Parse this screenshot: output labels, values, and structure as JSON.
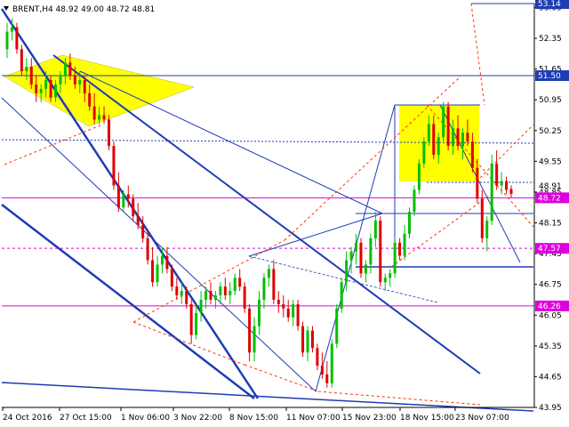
{
  "chart_data": {
    "type": "candlestick",
    "title": "BRENT,H4 48.92 49.00 48.72 48.81",
    "symbol": "BRENT",
    "timeframe": "H4",
    "ohlc": {
      "open": 48.92,
      "high": 49.0,
      "low": 48.72,
      "close": 48.81
    },
    "ylim": [
      43.95,
      53.14
    ],
    "y_ticks": [
      "53.05",
      "52.35",
      "51.65",
      "50.95",
      "50.25",
      "49.55",
      "48.85",
      "48.15",
      "47.45",
      "46.75",
      "46.05",
      "45.35",
      "44.65",
      "43.95"
    ],
    "x_tick_labels": [
      "24 Oct 2016",
      "27 Oct 15:00",
      "1 Nov 06:00",
      "3 Nov 22:00",
      "8 Nov 15:00",
      "11 Nov 07:00",
      "15 Nov 23:00",
      "18 Nov 15:00",
      "23 Nov 07:00"
    ],
    "price_levels": [
      {
        "label": "53.14",
        "value": 53.14,
        "color": "#1e3cb4"
      },
      {
        "label": "51.50",
        "value": 51.5,
        "color": "#1e3cb4"
      },
      {
        "label": "48.72",
        "value": 48.72,
        "color": "#dd00dd"
      },
      {
        "label": "47.57",
        "value": 47.57,
        "color": "#dd00dd"
      },
      {
        "label": "46.26",
        "value": 46.26,
        "color": "#dd00dd"
      }
    ],
    "hidden_tick": "48.91",
    "colors": {
      "bull": "#00c000",
      "bear": "#e00000",
      "trendline": "#1e3cb4",
      "level": "#dd00dd",
      "projection": "#ff3300",
      "highlight": "#ffff00"
    },
    "candles": [
      [
        52.1,
        52.7,
        51.9,
        52.5
      ],
      [
        52.5,
        52.8,
        52.3,
        52.6
      ],
      [
        52.6,
        52.7,
        52.0,
        52.1
      ],
      [
        52.1,
        52.2,
        51.5,
        51.6
      ],
      [
        51.6,
        51.9,
        51.4,
        51.7
      ],
      [
        51.7,
        51.9,
        51.2,
        51.3
      ],
      [
        51.3,
        51.5,
        50.9,
        51.1
      ],
      [
        51.1,
        51.3,
        50.9,
        51.2
      ],
      [
        51.2,
        51.6,
        51.0,
        51.4
      ],
      [
        51.4,
        51.5,
        50.9,
        51.0
      ],
      [
        51.0,
        51.4,
        50.9,
        51.3
      ],
      [
        51.3,
        51.6,
        51.1,
        51.5
      ],
      [
        51.5,
        51.9,
        51.3,
        51.8
      ],
      [
        51.8,
        52.0,
        51.4,
        51.5
      ],
      [
        51.5,
        51.7,
        51.2,
        51.3
      ],
      [
        51.3,
        51.6,
        51.1,
        51.4
      ],
      [
        51.4,
        51.5,
        50.9,
        51.1
      ],
      [
        51.1,
        51.3,
        50.7,
        50.8
      ],
      [
        50.8,
        51.1,
        50.4,
        50.5
      ],
      [
        50.5,
        50.8,
        50.4,
        50.6
      ],
      [
        50.6,
        50.8,
        50.4,
        50.5
      ],
      [
        50.5,
        50.6,
        49.8,
        49.9
      ],
      [
        49.9,
        50.0,
        48.9,
        49.0
      ],
      [
        49.0,
        49.3,
        48.4,
        48.5
      ],
      [
        48.5,
        48.9,
        48.4,
        48.8
      ],
      [
        48.8,
        49.0,
        48.5,
        48.7
      ],
      [
        48.7,
        48.8,
        48.2,
        48.3
      ],
      [
        48.3,
        48.6,
        48.0,
        48.1
      ],
      [
        48.1,
        48.3,
        47.7,
        47.8
      ],
      [
        47.8,
        48.0,
        47.2,
        47.3
      ],
      [
        47.3,
        47.6,
        46.7,
        46.8
      ],
      [
        46.8,
        47.4,
        46.7,
        47.2
      ],
      [
        47.2,
        47.6,
        47.0,
        47.4
      ],
      [
        47.4,
        47.6,
        47.0,
        47.1
      ],
      [
        47.1,
        47.2,
        46.6,
        46.7
      ],
      [
        46.7,
        46.9,
        46.4,
        46.5
      ],
      [
        46.5,
        46.8,
        46.3,
        46.6
      ],
      [
        46.6,
        46.7,
        46.2,
        46.3
      ],
      [
        46.3,
        46.4,
        45.4,
        45.6
      ],
      [
        45.6,
        46.3,
        45.5,
        46.1
      ],
      [
        46.1,
        46.6,
        45.9,
        46.4
      ],
      [
        46.4,
        46.7,
        46.2,
        46.6
      ],
      [
        46.6,
        46.8,
        46.3,
        46.4
      ],
      [
        46.4,
        46.6,
        46.2,
        46.5
      ],
      [
        46.5,
        46.8,
        46.3,
        46.7
      ],
      [
        46.7,
        46.9,
        46.4,
        46.5
      ],
      [
        46.5,
        46.8,
        46.3,
        46.6
      ],
      [
        46.6,
        47.0,
        46.5,
        46.9
      ],
      [
        46.9,
        47.1,
        46.6,
        46.7
      ],
      [
        46.7,
        46.8,
        46.1,
        46.2
      ],
      [
        46.2,
        46.3,
        45.0,
        45.2
      ],
      [
        45.2,
        46.0,
        45.0,
        45.8
      ],
      [
        45.8,
        46.6,
        45.6,
        46.4
      ],
      [
        46.4,
        47.0,
        46.2,
        46.9
      ],
      [
        46.9,
        47.2,
        46.7,
        47.1
      ],
      [
        47.1,
        47.3,
        46.3,
        46.4
      ],
      [
        46.4,
        46.6,
        46.1,
        46.3
      ],
      [
        46.3,
        46.5,
        46.0,
        46.2
      ],
      [
        46.2,
        46.4,
        45.9,
        46.0
      ],
      [
        46.0,
        46.4,
        45.8,
        46.3
      ],
      [
        46.3,
        46.4,
        45.7,
        45.8
      ],
      [
        45.8,
        45.9,
        45.1,
        45.2
      ],
      [
        45.2,
        45.8,
        45.0,
        45.7
      ],
      [
        45.7,
        45.8,
        45.2,
        45.3
      ],
      [
        45.3,
        45.4,
        44.8,
        44.9
      ],
      [
        44.9,
        45.2,
        44.6,
        44.7
      ],
      [
        44.7,
        45.0,
        44.4,
        44.5
      ],
      [
        44.5,
        45.5,
        44.4,
        45.4
      ],
      [
        45.4,
        46.3,
        45.3,
        46.2
      ],
      [
        46.2,
        46.9,
        46.1,
        46.8
      ],
      [
        46.8,
        47.5,
        46.6,
        47.3
      ],
      [
        47.3,
        47.6,
        47.0,
        47.5
      ],
      [
        47.5,
        47.9,
        47.2,
        47.7
      ],
      [
        47.7,
        47.8,
        46.9,
        47.0
      ],
      [
        47.0,
        47.3,
        46.8,
        47.2
      ],
      [
        47.2,
        47.9,
        47.0,
        47.8
      ],
      [
        47.8,
        48.4,
        47.6,
        48.2
      ],
      [
        48.2,
        48.3,
        46.7,
        46.8
      ],
      [
        46.8,
        47.0,
        46.6,
        46.9
      ],
      [
        46.9,
        47.1,
        46.7,
        47.0
      ],
      [
        47.0,
        47.8,
        46.9,
        47.7
      ],
      [
        47.7,
        47.8,
        47.3,
        47.4
      ],
      [
        47.4,
        48.1,
        47.3,
        47.9
      ],
      [
        47.9,
        48.5,
        47.8,
        48.4
      ],
      [
        48.4,
        49.0,
        48.3,
        48.9
      ],
      [
        48.9,
        49.6,
        48.8,
        49.5
      ],
      [
        49.5,
        50.1,
        49.4,
        50.0
      ],
      [
        50.0,
        50.6,
        49.9,
        50.4
      ],
      [
        50.4,
        50.6,
        49.6,
        49.7
      ],
      [
        49.7,
        50.2,
        49.5,
        50.1
      ],
      [
        50.1,
        50.9,
        50.0,
        50.8
      ],
      [
        50.8,
        50.9,
        49.8,
        49.9
      ],
      [
        49.9,
        50.5,
        49.7,
        50.3
      ],
      [
        50.3,
        50.6,
        49.8,
        49.9
      ],
      [
        49.9,
        50.3,
        49.6,
        50.2
      ],
      [
        50.2,
        50.5,
        49.9,
        50.0
      ],
      [
        50.0,
        50.2,
        49.3,
        49.4
      ],
      [
        49.4,
        49.6,
        48.6,
        48.7
      ],
      [
        48.7,
        48.9,
        47.7,
        47.8
      ],
      [
        47.8,
        48.3,
        47.5,
        48.2
      ],
      [
        48.2,
        49.7,
        48.1,
        49.5
      ],
      [
        49.5,
        49.8,
        48.9,
        49.0
      ],
      [
        49.0,
        49.3,
        48.8,
        49.1
      ],
      [
        49.1,
        49.2,
        48.8,
        48.9
      ],
      [
        48.92,
        49.0,
        48.72,
        48.81
      ]
    ]
  }
}
